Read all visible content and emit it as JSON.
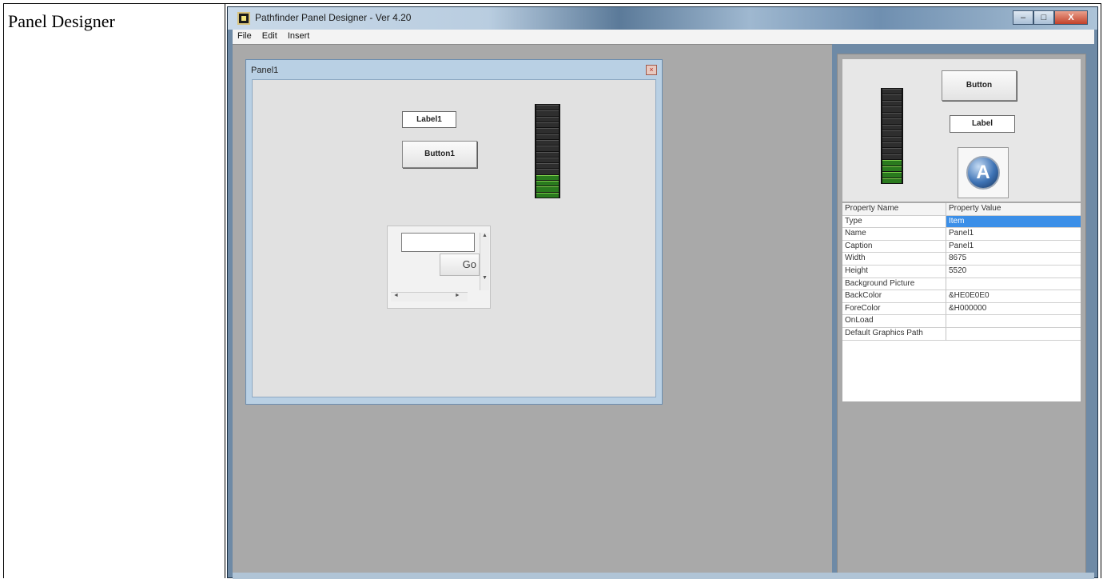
{
  "document": {
    "row_label": "Panel Designer"
  },
  "window": {
    "title": "Pathfinder Panel Designer - Ver 4.20",
    "buttons": {
      "minimize": "–",
      "maximize": "□",
      "close": "X"
    }
  },
  "menu": {
    "items": [
      "File",
      "Edit",
      "Insert"
    ]
  },
  "panel": {
    "title": "Panel1",
    "close_glyph": "×",
    "label_text": "Label1",
    "button_text": "Button1",
    "meter_level": 0.25,
    "mini": {
      "go_text": "Go",
      "scroll_up": "▲",
      "scroll_down": "▼",
      "scroll_left": "◄",
      "scroll_right": "►"
    }
  },
  "toolbox": {
    "button_text": "Button",
    "label_text": "Label",
    "meter_level": 0.25,
    "logo_icon": "A"
  },
  "properties": {
    "header": {
      "name": "Property Name",
      "value": "Property Value"
    },
    "rows": [
      {
        "name": "Type",
        "value": "Item",
        "selected": true
      },
      {
        "name": "Name",
        "value": "Panel1"
      },
      {
        "name": "Caption",
        "value": "Panel1"
      },
      {
        "name": "Width",
        "value": "8675"
      },
      {
        "name": "Height",
        "value": "5520"
      },
      {
        "name": "Background Picture",
        "value": ""
      },
      {
        "name": "BackColor",
        "value": "&HE0E0E0"
      },
      {
        "name": "ForeColor",
        "value": "&H000000"
      },
      {
        "name": "OnLoad",
        "value": ""
      },
      {
        "name": "Default Graphics Path",
        "value": ""
      }
    ]
  },
  "colors": {
    "selection": "#3b8fe8",
    "meter_on": "#2a7a1e",
    "workspace": "#a9a9a9"
  }
}
